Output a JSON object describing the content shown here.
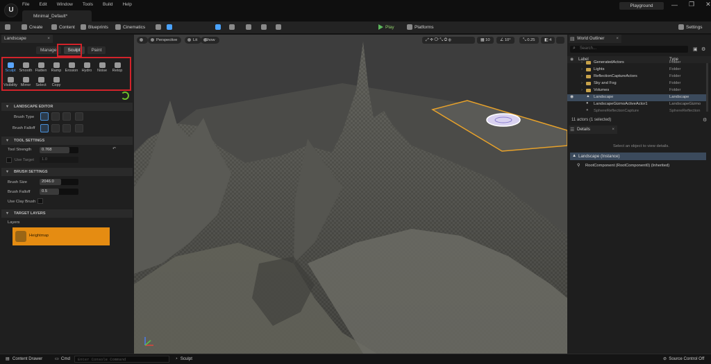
{
  "app": {
    "logo": "U",
    "project_tab": "Minimal_Default*",
    "level_button": "Playground",
    "window_controls": [
      "—",
      "❐",
      "✕"
    ]
  },
  "menu": [
    "File",
    "Edit",
    "Window",
    "Tools",
    "Build",
    "Help"
  ],
  "toolbar": {
    "create": "Create",
    "content": "Content",
    "blueprints": "Blueprints",
    "cinematics": "Cinematics",
    "play": "Play",
    "platforms": "Platforms",
    "settings": "Settings"
  },
  "left_panel": {
    "tab": "Landscape",
    "modes": [
      "Manage",
      "Sculpt",
      "Paint"
    ],
    "tools_row1": [
      "Sculpt",
      "Smooth",
      "Flatten",
      "Ramp",
      "Erosion",
      "Hydro",
      "Noise",
      "Retop"
    ],
    "tools_row2": [
      "Visibility",
      "Mirror",
      "Select",
      "Copy"
    ],
    "landscape_editor": {
      "header": "LANDSCAPE EDITOR",
      "brush_type": "Brush Type",
      "brush_falloff": "Brush Falloff"
    },
    "tool_settings": {
      "header": "TOOL SETTINGS",
      "tool_strength": "Tool Strength",
      "tool_strength_value": "0.768",
      "tool_strength_fraction": 0.768,
      "use_target": "Use Target",
      "use_target_value": "1.0"
    },
    "brush_settings": {
      "header": "BRUSH SETTINGS",
      "brush_size": "Brush Size",
      "brush_size_value": "2046.0",
      "brush_falloff": "Brush Falloff",
      "brush_falloff_value": "0.5",
      "use_clay": "Use Clay Brush"
    },
    "target_layers": {
      "header": "TARGET LAYERS",
      "layers_label": "Layers",
      "layer_name": "Heightmap"
    }
  },
  "viewport": {
    "perspective": "Perspective",
    "lit": "Lit",
    "show": "Show",
    "grid": "10",
    "rotation": "10°",
    "scale": "0.25",
    "camera": "4"
  },
  "outliner": {
    "tab": "World Outliner",
    "search_placeholder": "Search...",
    "col_label": "Label",
    "col_type": "Type",
    "rows": [
      {
        "name": "GeneratedActors",
        "type": "Folder"
      },
      {
        "name": "Lights",
        "type": "Folder"
      },
      {
        "name": "ReflectionCaptureActors",
        "type": "Folder"
      },
      {
        "name": "Sky and Fog",
        "type": "Folder"
      },
      {
        "name": "Volumes",
        "type": "Folder"
      },
      {
        "name": "Landscape",
        "type": "Landscape"
      },
      {
        "name": "LandscapeGizmoActiveActor1",
        "type": "LandscapeGizmo"
      },
      {
        "name": "SphereReflectionCapture",
        "type": "SphereReflection"
      }
    ],
    "count": "11 actors (1 selected)"
  },
  "details": {
    "tab": "Details",
    "hint": "Select an object to view details.",
    "instance": "Landscape (Instance)",
    "component": "RootComponent (RootComponent0) (Inherited)"
  },
  "bottom": {
    "content_drawer": "Content Drawer",
    "cmd": "Cmd",
    "console_placeholder": "Enter Console Command",
    "mode": "Sculpt",
    "source_control": "Source Control Off"
  }
}
